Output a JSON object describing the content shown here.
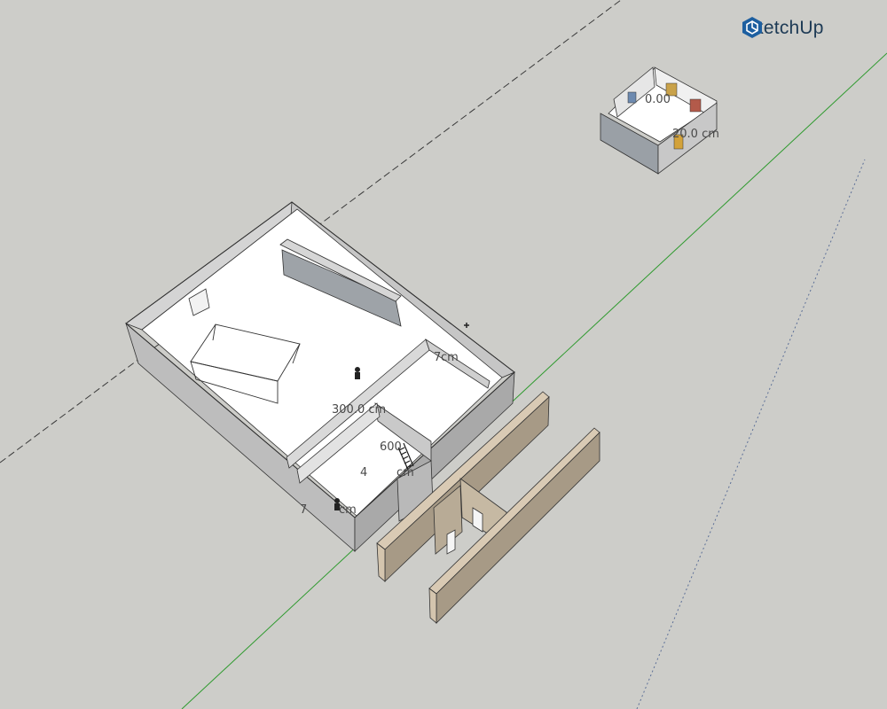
{
  "brand": {
    "name": "SketchUp",
    "icon": "sketchup-logo-icon",
    "color": "#1d5fa0"
  },
  "scene": {
    "background": "#cdcdc9",
    "axes": {
      "green_axis": "#2e9a2e",
      "red_axis_dashed": "#3a3a3a",
      "blue_axis_dotted": "#5c6f97"
    },
    "dimensions": {
      "d1": "300.0 cm",
      "d2": "600",
      "d3": "4",
      "d4": "cm",
      "d5": "7",
      "d6": "cm",
      "d7": "7",
      "d8": "cm",
      "d9": "20.0 cm",
      "d10": "0.00"
    }
  }
}
